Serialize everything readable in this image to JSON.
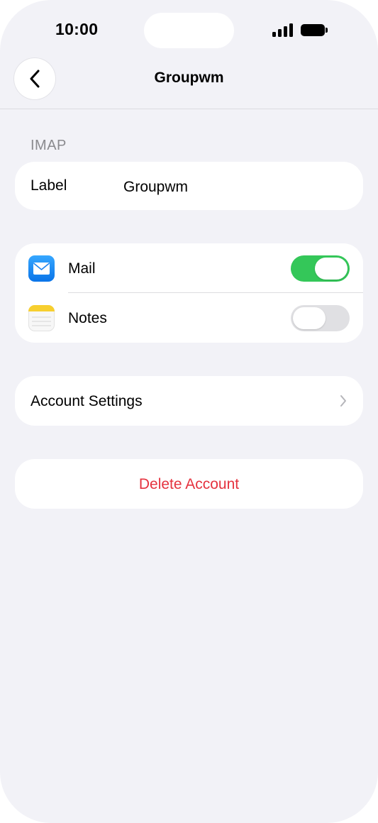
{
  "status_bar": {
    "time": "10:00",
    "icons": [
      "signal-icon",
      "battery-icon"
    ]
  },
  "nav": {
    "back_icon": "chevron-left-icon",
    "title": "Groupwm"
  },
  "account": {
    "section_header": "IMAP",
    "label_title": "Label",
    "label_value": "Groupwm"
  },
  "apps": [
    {
      "name": "Mail",
      "icon": "mail-icon",
      "enabled": true
    },
    {
      "name": "Notes",
      "icon": "notes-icon",
      "enabled": false
    }
  ],
  "account_settings": {
    "label": "Account Settings",
    "icon": "chevron-right-icon"
  },
  "delete": {
    "label": "Delete Account"
  },
  "colors": {
    "background": "#f2f2f7",
    "toggle_on": "#34c759",
    "toggle_off": "#e0e0e3",
    "destructive": "#e5333f",
    "secondary_text": "#8a8a8e"
  }
}
